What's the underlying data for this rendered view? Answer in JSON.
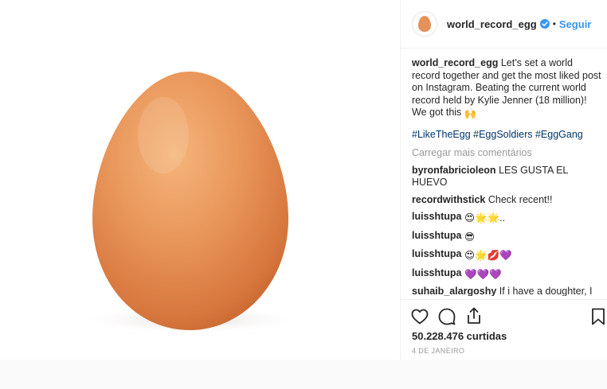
{
  "header": {
    "username": "world_record_egg",
    "separator": "•",
    "follow_label": "Seguir"
  },
  "caption": {
    "username": "world_record_egg",
    "text": "Let’s set a world record together and get the most liked post on Instagram. Beating the current world record held by Kylie Jenner (18 million)! We got this",
    "emoji": "🙌",
    "hashtags": "#LikeTheEgg #EggSoldiers #EggGang"
  },
  "load_more": "Carregar mais comentários",
  "comments": [
    {
      "user": "byronfabricioleon",
      "text": "LES GUSTA EL HUEVO",
      "emoji": ""
    },
    {
      "user": "recordwithstick",
      "text": "Check recent!!",
      "emoji": ""
    },
    {
      "user": "luisshtupa",
      "text": "",
      "emoji": "😍🌟🌟.."
    },
    {
      "user": "luisshtupa",
      "text": "",
      "emoji": "😎"
    },
    {
      "user": "luisshtupa",
      "text": "",
      "emoji": "😍🌟💋💜"
    },
    {
      "user": "luisshtupa",
      "text": "",
      "emoji": "💜💜💜"
    },
    {
      "user": "suhaib_alargoshy",
      "text": "If i have a doughter, I will name her an egg. Because of this famous that an egg have,now.",
      "emoji": ""
    }
  ],
  "actions": {
    "likes": "50.228.476 curtidas",
    "date": "4 DE JANEIRO",
    "icons": [
      "heart-icon",
      "comment-icon",
      "share-icon",
      "bookmark-icon"
    ]
  },
  "colors": {
    "follow": "#3897f0",
    "hashtag": "#003569",
    "muted": "#999999",
    "egg": "#e8955a"
  }
}
